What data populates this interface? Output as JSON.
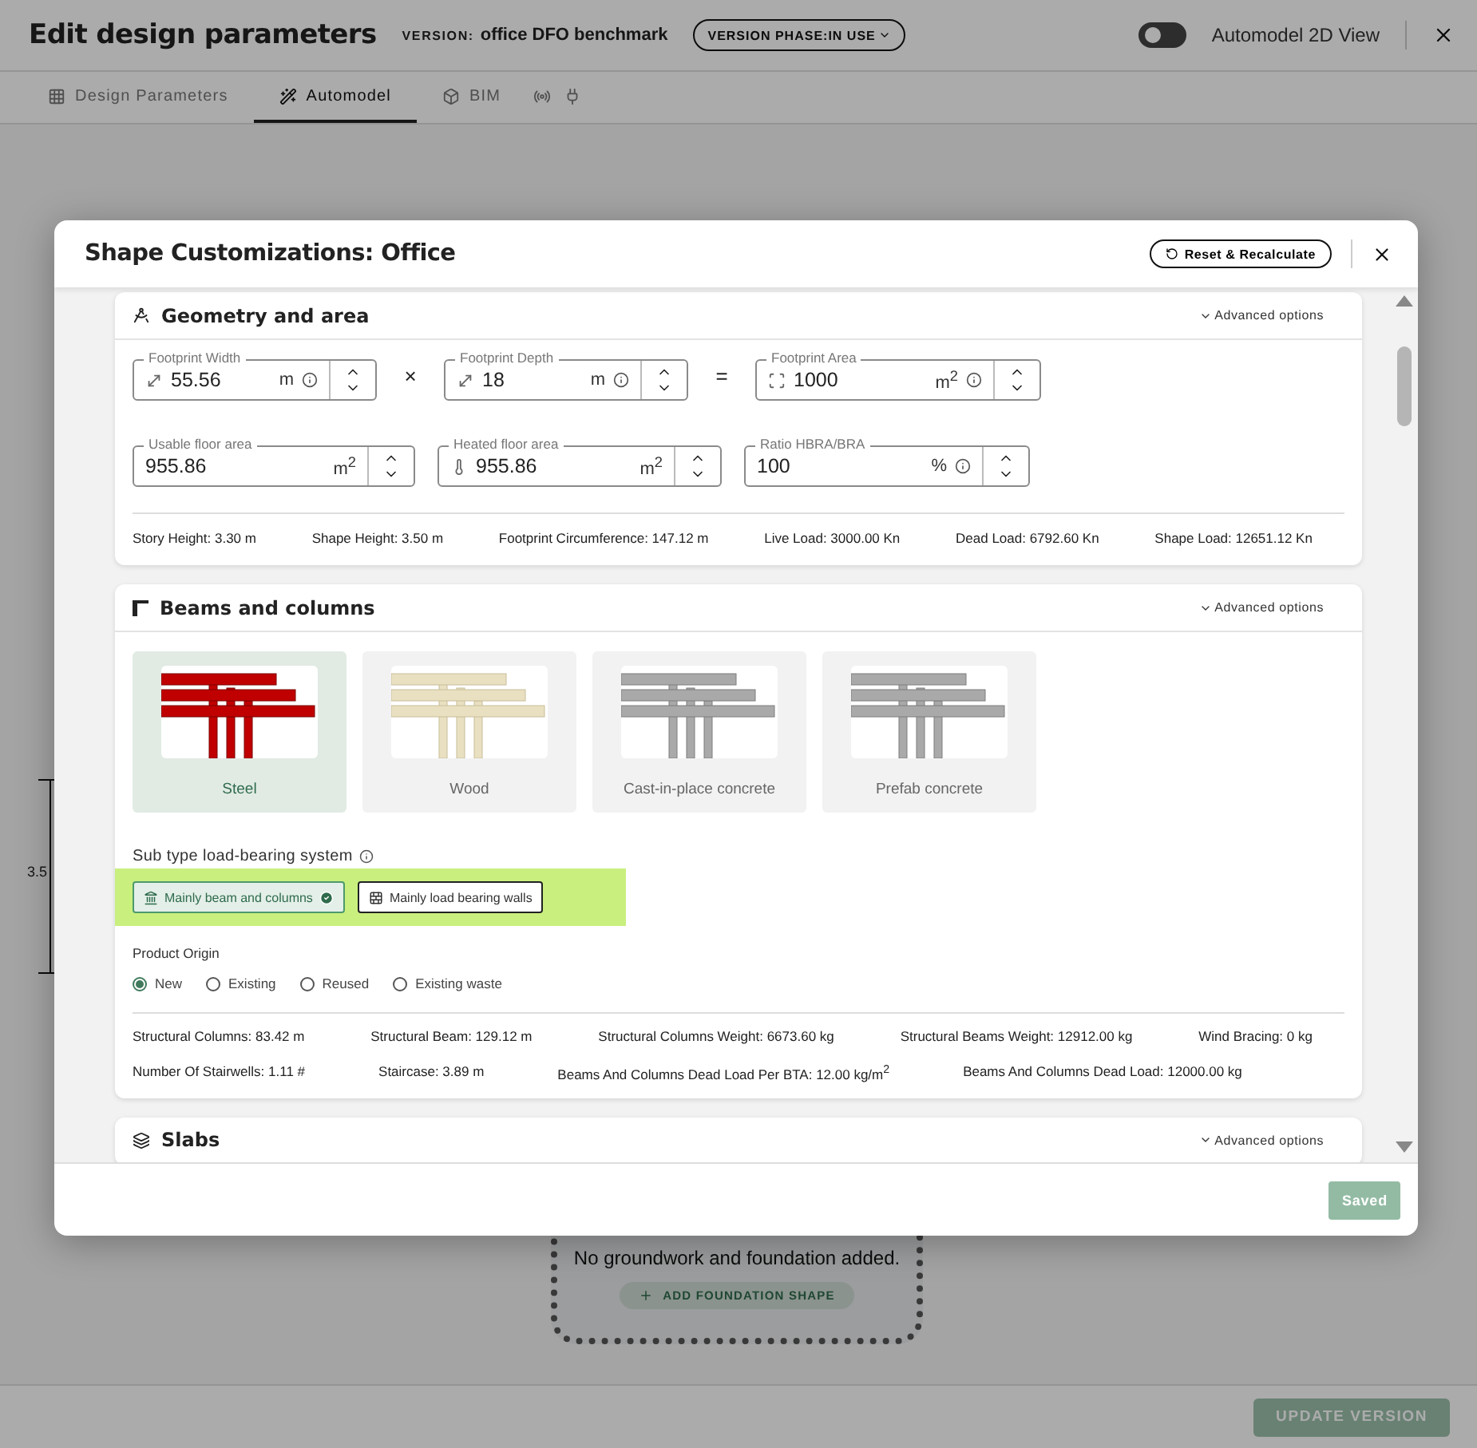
{
  "header": {
    "title": "Edit design parameters",
    "version_label": "VERSION:",
    "version_name": "office DFO benchmark",
    "phase_label": "VERSION PHASE:",
    "phase_value": "IN USE",
    "toggle": {
      "label": "Automodel 2D View",
      "on": false
    }
  },
  "tabs": [
    {
      "kind": "grid",
      "label": "Design Parameters",
      "selected": false
    },
    {
      "kind": "wand",
      "label": "Automodel",
      "selected": true
    },
    {
      "kind": "cube",
      "label": "BIM",
      "selected": false
    },
    {
      "kind": "antenna",
      "selected": false
    },
    {
      "kind": "plug",
      "selected": false
    }
  ],
  "canvas": {
    "dimension": "3.5",
    "empty_text": "No groundwork and foundation added.",
    "add_button": "ADD FOUNDATION SHAPE"
  },
  "footer_button": "UPDATE VERSION",
  "modal": {
    "title": "Shape Customizations: Office",
    "reset_button": "Reset & Recalculate",
    "saved_button": "Saved",
    "sections": [
      {
        "kind": "geometry",
        "title": "Geometry and area",
        "advanced": "Advanced options",
        "field_rows": [
          [
            {
              "kind": "field",
              "label": "Footprint Width",
              "value": "55.56",
              "unit": "m",
              "info": true
            },
            {
              "kind": "operator",
              "symbol": "×"
            },
            {
              "kind": "field",
              "label": "Footprint Depth",
              "value": "18",
              "unit": "m",
              "info": true
            },
            {
              "kind": "operator",
              "symbol": "="
            },
            {
              "kind": "field",
              "label": "Footprint Area",
              "value": "1000",
              "unit": "m$^{2}$",
              "info": true
            }
          ],
          [
            {
              "kind": "field",
              "label": "Usable floor area",
              "value": "955.86",
              "unit": "m$^{2}$",
              "info": false
            },
            {
              "kind": "field",
              "label": "Heated floor area",
              "value": "955.86",
              "unit": "m$^{2}$",
              "info": false
            },
            {
              "kind": "field",
              "label": "Ratio HBRA/BRA",
              "value": "100",
              "unit": "%",
              "info": true
            }
          ]
        ],
        "stats_rows": [
          [
            "Story Height: 3.30 m",
            "Shape Height: 3.50 m",
            "Footprint Circumference: 147.12 m",
            "Live Load: 3000.00 Kn",
            "Dead Load: 6792.60 Kn",
            "Shape Load: 12651.12 Kn"
          ]
        ]
      },
      {
        "kind": "beams",
        "title": "Beams and columns",
        "advanced": "Advanced options",
        "materials": [
          {
            "kind": "steel",
            "label": "Steel",
            "selected": true
          },
          {
            "kind": "wood",
            "label": "Wood",
            "selected": false
          },
          {
            "kind": "concrete",
            "label": "Cast-in-place concrete",
            "selected": false
          },
          {
            "kind": "concrete",
            "label": "Prefab concrete",
            "selected": false
          }
        ],
        "subtype": {
          "label": "Sub type load-bearing system",
          "options": [
            {
              "kind": "columns",
              "label": "Mainly beam and columns",
              "selected": true
            },
            {
              "kind": "walls",
              "label": "Mainly load bearing walls",
              "selected": false
            }
          ]
        },
        "origin": {
          "label": "Product Origin",
          "options": [
            {
              "label": "New",
              "selected": true
            },
            {
              "label": "Existing",
              "selected": false
            },
            {
              "label": "Reused",
              "selected": false
            },
            {
              "label": "Existing waste",
              "selected": false
            }
          ]
        },
        "stats_rows": [
          [
            "Structural Columns: 83.42 m",
            "Structural Beam: 129.12 m",
            "Structural Columns Weight: 6673.60 kg",
            "Structural Beams Weight: 12912.00 kg",
            "Wind Bracing: 0 kg"
          ],
          [
            "Number Of Stairwells: 1.11 #",
            "Staircase: 3.89 m",
            "Beams And Columns Dead Load Per BTA: 12.00 kg/m$^{2}$",
            "Beams And Columns Dead Load: 12000.00 kg"
          ]
        ]
      },
      {
        "kind": "slabs",
        "title": "Slabs",
        "advanced": "Advanced options"
      }
    ]
  }
}
